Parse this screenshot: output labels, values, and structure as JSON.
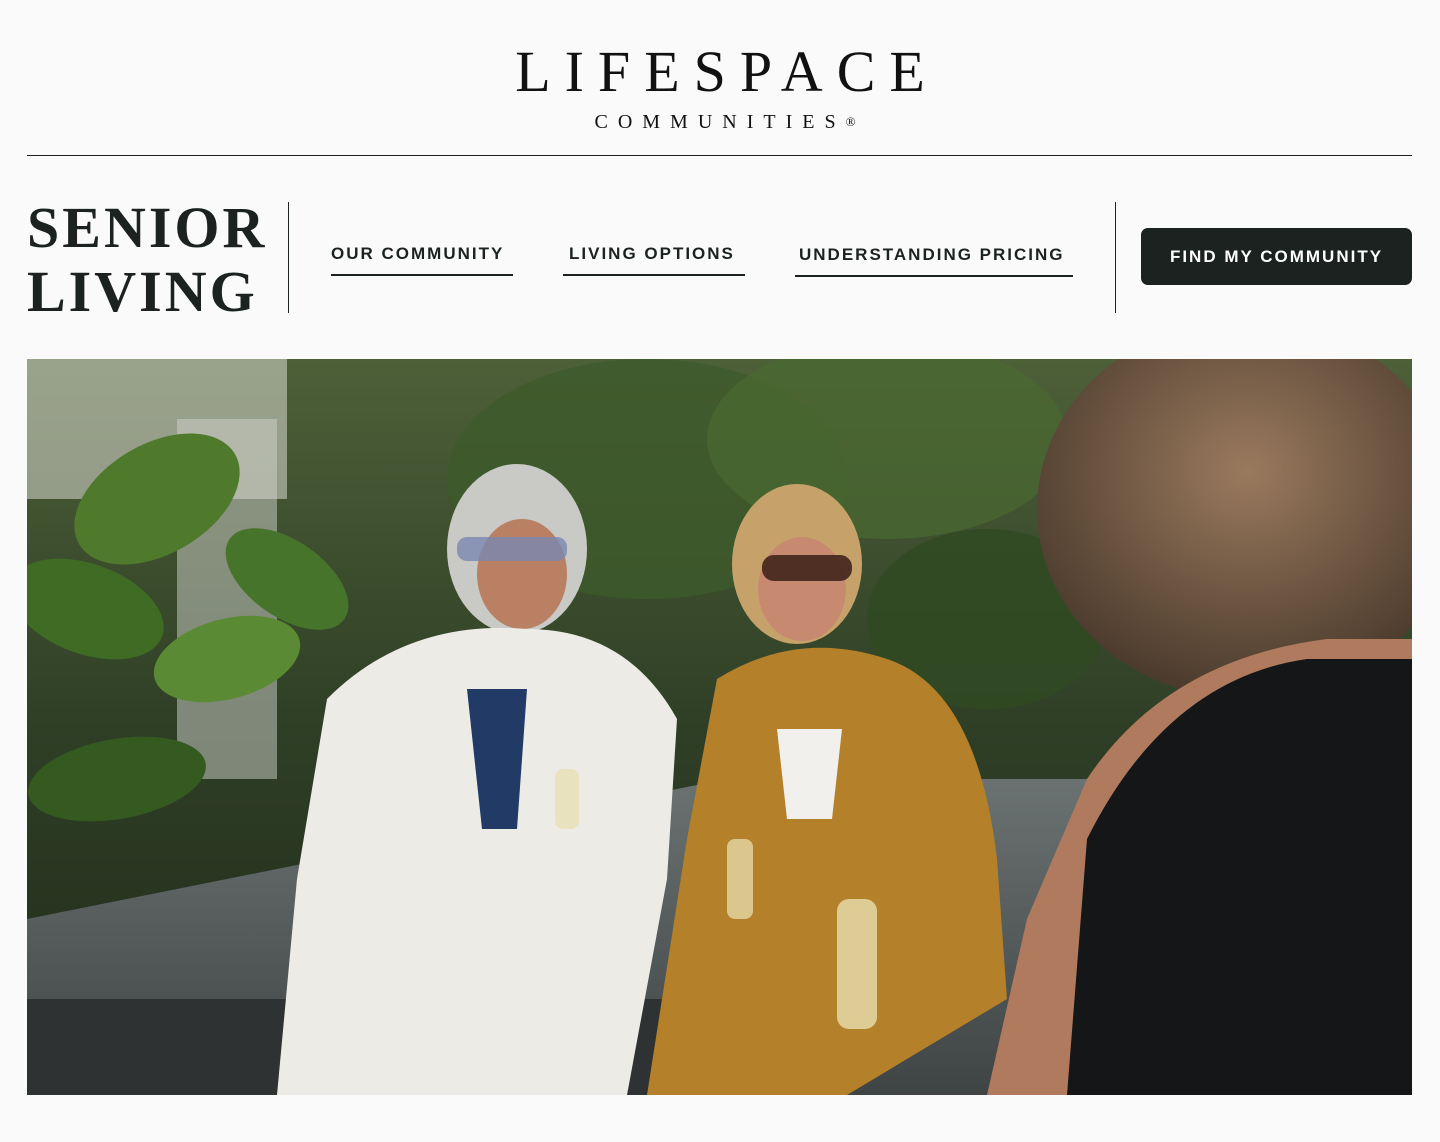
{
  "brand": {
    "name": "LIFESPACE",
    "tagline": "COMMUNITIES",
    "registered_mark": "®"
  },
  "section": {
    "title_line1": "SENIOR",
    "title_line2": "LIVING"
  },
  "nav": {
    "items": [
      {
        "label": "OUR COMMUNITY"
      },
      {
        "label": "LIVING OPTIONS"
      },
      {
        "label": "UNDERSTANDING PRICING"
      }
    ]
  },
  "cta": {
    "label": "FIND MY COMMUNITY"
  },
  "hero": {
    "icon": "photo-icon"
  },
  "colors": {
    "primary": "#1b2220",
    "background": "#fafafa",
    "cta_text": "#ffffff"
  }
}
